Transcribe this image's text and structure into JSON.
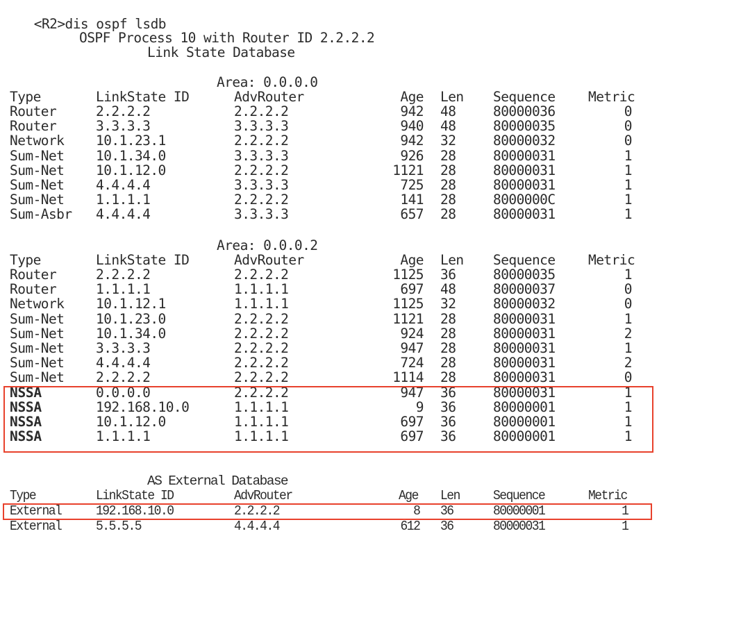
{
  "terminal": {
    "prompt": "<R2>",
    "command": "dis ospf lsdb",
    "process_title": "OSPF Process 10 with Router ID 2.2.2.2",
    "db_title": "Link State Database",
    "columns": {
      "type": "Type",
      "lsid": "LinkState ID",
      "adv": "AdvRouter",
      "age": "Age",
      "len": "Len",
      "seq": "Sequence",
      "metric": "Metric"
    },
    "areas": [
      {
        "label": "Area: 0.0.0.0",
        "rows": [
          {
            "type": "Router",
            "lsid": "2.2.2.2",
            "adv": "2.2.2.2",
            "age": "942",
            "len": "48",
            "seq": "80000036",
            "metric": "0"
          },
          {
            "type": "Router",
            "lsid": "3.3.3.3",
            "adv": "3.3.3.3",
            "age": "940",
            "len": "48",
            "seq": "80000035",
            "metric": "0"
          },
          {
            "type": "Network",
            "lsid": "10.1.23.1",
            "adv": "2.2.2.2",
            "age": "942",
            "len": "32",
            "seq": "80000032",
            "metric": "0"
          },
          {
            "type": "Sum-Net",
            "lsid": "10.1.34.0",
            "adv": "3.3.3.3",
            "age": "926",
            "len": "28",
            "seq": "80000031",
            "metric": "1"
          },
          {
            "type": "Sum-Net",
            "lsid": "10.1.12.0",
            "adv": "2.2.2.2",
            "age": "1121",
            "len": "28",
            "seq": "80000031",
            "metric": "1"
          },
          {
            "type": "Sum-Net",
            "lsid": "4.4.4.4",
            "adv": "3.3.3.3",
            "age": "725",
            "len": "28",
            "seq": "80000031",
            "metric": "1"
          },
          {
            "type": "Sum-Net",
            "lsid": "1.1.1.1",
            "adv": "2.2.2.2",
            "age": "141",
            "len": "28",
            "seq": "8000000C",
            "metric": "1"
          },
          {
            "type": "Sum-Asbr",
            "lsid": "4.4.4.4",
            "adv": "3.3.3.3",
            "age": "657",
            "len": "28",
            "seq": "80000031",
            "metric": "1"
          }
        ]
      },
      {
        "label": "Area: 0.0.0.2",
        "rows": [
          {
            "type": "Router",
            "lsid": "2.2.2.2",
            "adv": "2.2.2.2",
            "age": "1125",
            "len": "36",
            "seq": "80000035",
            "metric": "1"
          },
          {
            "type": "Router",
            "lsid": "1.1.1.1",
            "adv": "1.1.1.1",
            "age": "697",
            "len": "48",
            "seq": "80000037",
            "metric": "0"
          },
          {
            "type": "Network",
            "lsid": "10.1.12.1",
            "adv": "1.1.1.1",
            "age": "1125",
            "len": "32",
            "seq": "80000032",
            "metric": "0"
          },
          {
            "type": "Sum-Net",
            "lsid": "10.1.23.0",
            "adv": "2.2.2.2",
            "age": "1121",
            "len": "28",
            "seq": "80000031",
            "metric": "1"
          },
          {
            "type": "Sum-Net",
            "lsid": "10.1.34.0",
            "adv": "2.2.2.2",
            "age": "924",
            "len": "28",
            "seq": "80000031",
            "metric": "2"
          },
          {
            "type": "Sum-Net",
            "lsid": "3.3.3.3",
            "adv": "2.2.2.2",
            "age": "947",
            "len": "28",
            "seq": "80000031",
            "metric": "1"
          },
          {
            "type": "Sum-Net",
            "lsid": "4.4.4.4",
            "adv": "2.2.2.2",
            "age": "724",
            "len": "28",
            "seq": "80000031",
            "metric": "2"
          },
          {
            "type": "Sum-Net",
            "lsid": "2.2.2.2",
            "adv": "2.2.2.2",
            "age": "1114",
            "len": "28",
            "seq": "80000031",
            "metric": "0"
          },
          {
            "type": "NSSA",
            "lsid": "0.0.0.0",
            "adv": "2.2.2.2",
            "age": "947",
            "len": "36",
            "seq": "80000031",
            "metric": "1"
          },
          {
            "type": "NSSA",
            "lsid": "192.168.10.0",
            "adv": "1.1.1.1",
            "age": "9",
            "len": "36",
            "seq": "80000001",
            "metric": "1"
          },
          {
            "type": "NSSA",
            "lsid": "10.1.12.0",
            "adv": "1.1.1.1",
            "age": "697",
            "len": "36",
            "seq": "80000001",
            "metric": "1"
          },
          {
            "type": "NSSA",
            "lsid": "1.1.1.1",
            "adv": "1.1.1.1",
            "age": "697",
            "len": "36",
            "seq": "80000001",
            "metric": "1"
          }
        ]
      }
    ],
    "external": {
      "label": "AS External Database",
      "rows": [
        {
          "type": "External",
          "lsid": "192.168.10.0",
          "adv": "2.2.2.2",
          "age": "8",
          "len": "36",
          "seq": "80000001",
          "metric": "1"
        },
        {
          "type": "External",
          "lsid": "5.5.5.5",
          "adv": "4.4.4.4",
          "age": "612",
          "len": "36",
          "seq": "80000031",
          "metric": "1"
        }
      ]
    },
    "highlight_color": "#e8412c"
  }
}
